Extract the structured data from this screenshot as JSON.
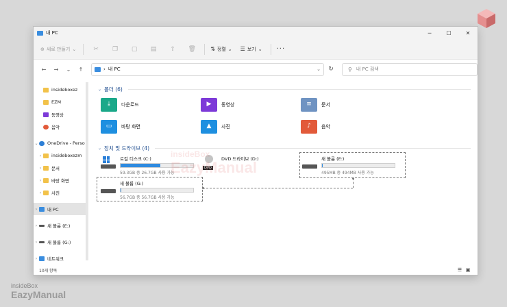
{
  "window": {
    "title": "내 PC"
  },
  "toolbar": {
    "new_label": "새로 만들기",
    "sort_label": "정렬",
    "view_label": "보기",
    "more_label": "···"
  },
  "address": {
    "path": "내 PC"
  },
  "search": {
    "placeholder": "내 PC 검색"
  },
  "sidebar": {
    "items": [
      {
        "label": "insideboxez"
      },
      {
        "label": "EZM"
      },
      {
        "label": "동영상"
      },
      {
        "label": "음악"
      },
      {
        "label": "OneDrive - Perso"
      },
      {
        "label": "insideboxezm"
      },
      {
        "label": "문서"
      },
      {
        "label": "바탕 화면"
      },
      {
        "label": "사진"
      },
      {
        "label": "내 PC"
      },
      {
        "label": "새 볼륨 (E:)"
      },
      {
        "label": "새 볼륨 (G:)"
      },
      {
        "label": "네트워크"
      }
    ]
  },
  "sections": {
    "folders": "폴더 (6)",
    "drives": "장치 및 드라이브 (4)"
  },
  "folders": [
    {
      "label": "다운로드",
      "color": "#1aa889"
    },
    {
      "label": "동영상",
      "color": "#7d3ad8"
    },
    {
      "label": "문서",
      "color": "#6f93c2"
    },
    {
      "label": "바탕 화면",
      "color": "#1e8fe0"
    },
    {
      "label": "사진",
      "color": "#1e8fe0"
    },
    {
      "label": "음악",
      "color": "#e25a3a"
    }
  ],
  "drives": {
    "c": {
      "name": "로컬 디스크 (C:)",
      "free": "59.3GB 중 26.7GB 사용 가능",
      "used_fraction": 0.55
    },
    "d": {
      "name": "DVD 드라이브 (D:)",
      "badge": "DVD"
    },
    "e": {
      "name": "새 볼륨 (E:)",
      "free": "495MB 중 494MB 사용 가능",
      "used_fraction": 0.01
    },
    "g": {
      "name": "새 볼륨 (G:)",
      "free": "56.7GB 중 56.7GB 사용 가능",
      "used_fraction": 0.01
    }
  },
  "status": {
    "count": "10개 항목"
  },
  "brand": {
    "line1": "insideBox",
    "line2": "EazyManual"
  },
  "watermark": {
    "line1": "insideBox",
    "line2": "EazyManual"
  }
}
